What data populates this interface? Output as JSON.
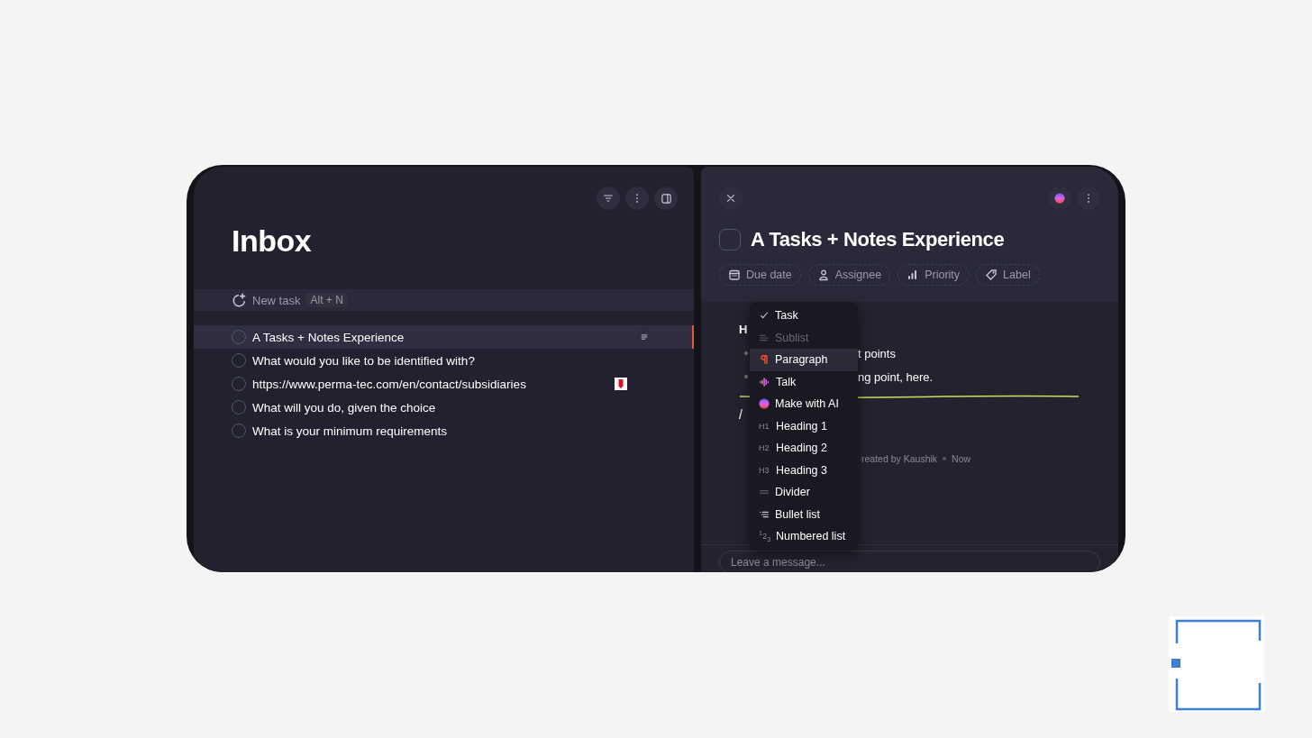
{
  "list_panel": {
    "title": "Inbox",
    "new_task": {
      "placeholder": "New task",
      "shortcut": "Alt + N"
    },
    "tasks": [
      {
        "title": "A Tasks + Notes Experience",
        "kind": "note",
        "checked": false,
        "selected": true
      },
      {
        "title": "What would you like to be identified with?",
        "kind": "plain",
        "checked": false,
        "selected": false
      },
      {
        "title": "https://www.perma-tec.com/en/contact/subsidiaries",
        "kind": "link",
        "checked": false,
        "selected": false
      },
      {
        "title": "What will you do, given the choice",
        "kind": "plain",
        "checked": false,
        "selected": false
      },
      {
        "title": "What is your minimum requirements",
        "kind": "plain",
        "checked": false,
        "selected": false
      }
    ]
  },
  "detail": {
    "title": "A Tasks + Notes Experience",
    "checked": false,
    "properties": [
      {
        "label": "Due date",
        "kind": "date"
      },
      {
        "label": "Assignee",
        "kind": "person"
      },
      {
        "label": "Priority",
        "kind": "priority"
      },
      {
        "label": "Label",
        "kind": "tag"
      }
    ],
    "content": [
      {
        "kind": "heading",
        "text": "H"
      },
      {
        "kind": "bullet",
        "text": "t points"
      },
      {
        "kind": "bullet",
        "text": "ng point, here."
      },
      {
        "kind": "divider"
      },
      {
        "kind": "slash",
        "text": "/"
      }
    ],
    "meta": {
      "author": "reated by Kaushik",
      "time": "Now"
    },
    "composer": {
      "placeholder": "Leave a message..."
    }
  },
  "block_menu": [
    {
      "label": "Task",
      "kind": "check",
      "disabled": false,
      "selected": false
    },
    {
      "label": "Sublist",
      "kind": "sublist",
      "disabled": true,
      "selected": false
    },
    {
      "label": "Paragraph",
      "kind": "paragraph",
      "disabled": false,
      "selected": true
    },
    {
      "label": "Talk",
      "kind": "talk",
      "disabled": false,
      "selected": false
    },
    {
      "label": "Make with AI",
      "kind": "ai",
      "disabled": false,
      "selected": false
    },
    {
      "label": "Heading 1",
      "kind": "heading",
      "badge": "H1",
      "disabled": false,
      "selected": false
    },
    {
      "label": "Heading 2",
      "kind": "heading",
      "badge": "H2",
      "disabled": false,
      "selected": false
    },
    {
      "label": "Heading 3",
      "kind": "heading",
      "badge": "H3",
      "disabled": false,
      "selected": false
    },
    {
      "label": "Divider",
      "kind": "divider",
      "disabled": false,
      "selected": false
    },
    {
      "label": "Bullet list",
      "kind": "bullets",
      "disabled": false,
      "selected": false
    },
    {
      "label": "Numbered list",
      "kind": "numbers",
      "badge": "$^{1}$2$_{3}$",
      "disabled": false,
      "selected": false
    }
  ]
}
